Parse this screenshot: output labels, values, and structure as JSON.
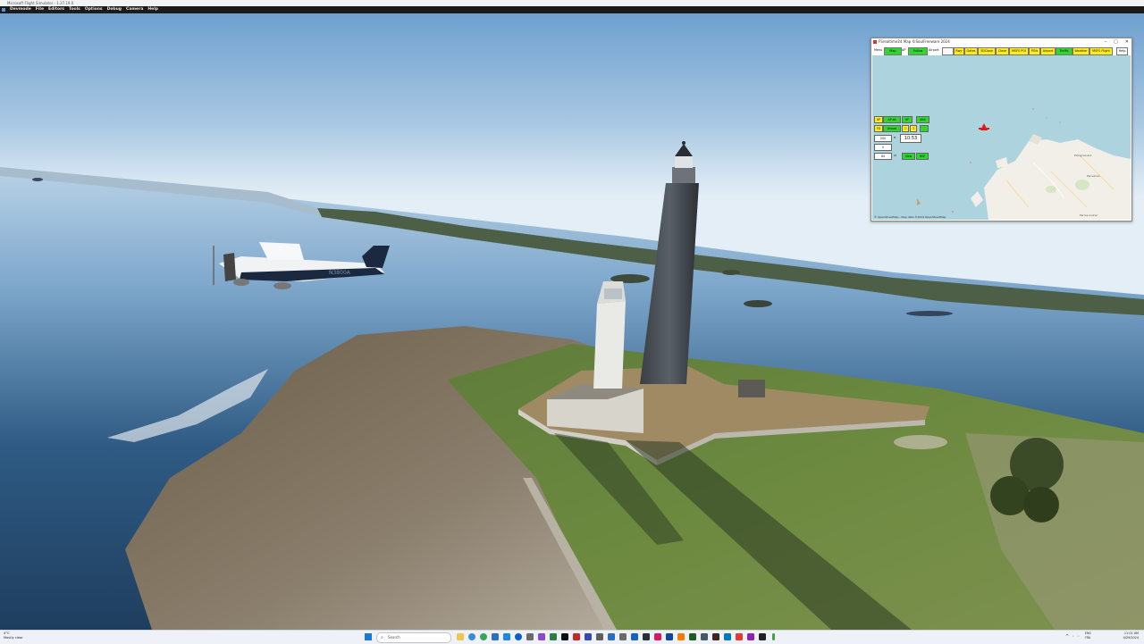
{
  "window": {
    "title": "Microsoft Flight Simulator - 1.37.19.0",
    "menu": [
      "Devmode",
      "File",
      "Editors",
      "Tools",
      "Options",
      "Debug",
      "Camera",
      "Help"
    ]
  },
  "scene": {
    "aircraft_registration": "N3800A"
  },
  "map_window": {
    "title": "FSrealtime24 Map ©SoulFreeware 2024",
    "controls": [
      "–",
      "▢",
      "✕"
    ],
    "toolbar": {
      "menu_label": "Menu",
      "btn1": "Map",
      "btn2_label": "AP",
      "btn3": "Follow",
      "airport_label": "Airport",
      "airport_value": "",
      "right_buttons": [
        "Rwy",
        "Gates",
        "3DClose",
        "Close",
        "MSFS POI",
        "POIs",
        "Airport",
        "Traffic",
        "Weather",
        "MSFS Flight",
        "Help"
      ]
    },
    "panel": {
      "row1": [
        "AP",
        "AP alt",
        "HF",
        "Altit"
      ],
      "row2": [
        "FD",
        "Ahead",
        "2",
        "3"
      ],
      "row3_value": "200",
      "row3_unit": "ft",
      "time": "10:53",
      "row4_value": "0",
      "row5_value": "84",
      "row5_unit": "kt",
      "row5_buttons": [
        "Slew",
        "MSF"
      ]
    },
    "attribution": "© OpenStreetMap - Map data ©2024 OpenStreetMap",
    "town_labels": [
      "Plougrescant",
      "Penvénan",
      "Perros-Guirec"
    ]
  },
  "taskbar": {
    "weather_temp": "4°C",
    "weather_desc": "Mostly clear",
    "search_placeholder": "Search",
    "language": "ENG\nFRA",
    "clock_time": "11:01 AM",
    "clock_date": "4/29/2024"
  },
  "colors": {
    "accent_green": "#2ed62e",
    "accent_yellow": "#ffec1a",
    "map_sea": "#acd3de",
    "map_land": "#f2efe9"
  }
}
